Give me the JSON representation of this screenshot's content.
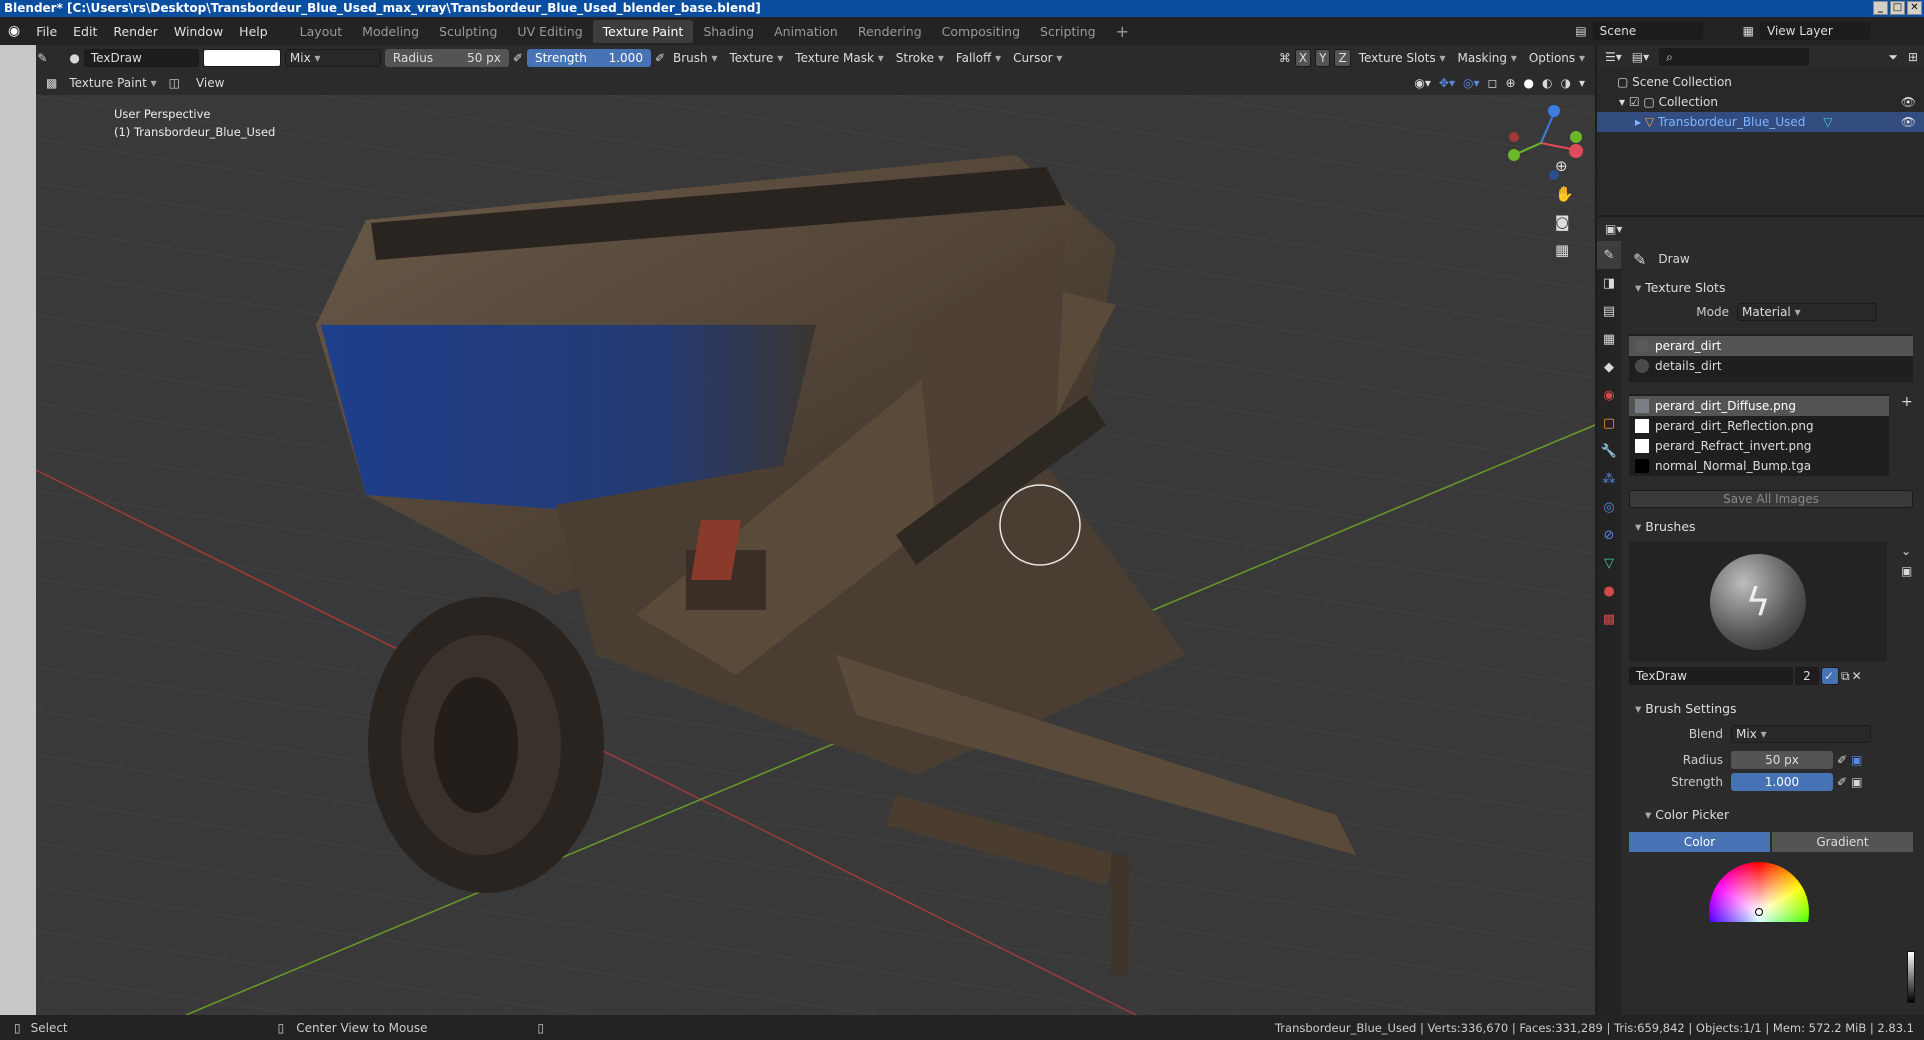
{
  "window": {
    "title": "Blender* [C:\\Users\\rs\\Desktop\\Transbordeur_Blue_Used_max_vray\\Transbordeur_Blue_Used_blender_base.blend]"
  },
  "menu": [
    "File",
    "Edit",
    "Render",
    "Window",
    "Help"
  ],
  "workspaces": [
    "Layout",
    "Modeling",
    "Sculpting",
    "UV Editing",
    "Texture Paint",
    "Shading",
    "Animation",
    "Rendering",
    "Compositing",
    "Scripting"
  ],
  "active_workspace": "Texture Paint",
  "scene": {
    "name": "Scene",
    "view_layer": "View Layer"
  },
  "tool_header": {
    "brush_name": "TexDraw",
    "blend": "Mix",
    "radius_label": "Radius",
    "radius_value": "50 px",
    "strength_label": "Strength",
    "strength_value": "1.000",
    "menus": [
      "Brush",
      "Texture",
      "Texture Mask",
      "Stroke",
      "Falloff",
      "Cursor"
    ],
    "axes": [
      "X",
      "Y",
      "Z"
    ],
    "right_menus": [
      "Texture Slots",
      "Masking",
      "Options"
    ]
  },
  "viewport_header": {
    "mode": "Texture Paint",
    "view": "View"
  },
  "viewport": {
    "perspective": "User Perspective",
    "object": "(1) Transbordeur_Blue_Used"
  },
  "outliner": {
    "root": "Scene Collection",
    "collection": "Collection",
    "object": "Transbordeur_Blue_Used"
  },
  "properties": {
    "tool": "Draw",
    "texture_slots": {
      "header": "Texture Slots",
      "mode_label": "Mode",
      "mode_value": "Material",
      "materials": [
        "perard_dirt",
        "details_dirt"
      ],
      "images": [
        {
          "name": "perard_dirt_Diffuse.png",
          "color": "#7a7f86"
        },
        {
          "name": "perard_dirt_Reflection.png",
          "color": "#ffffff"
        },
        {
          "name": "perard_Refract_invert.png",
          "color": "#ffffff"
        },
        {
          "name": "normal_Normal_Bump.tga",
          "color": "#000000"
        }
      ],
      "save_all": "Save All Images"
    },
    "brushes": {
      "header": "Brushes",
      "name": "TexDraw",
      "users": "2"
    },
    "brush_settings": {
      "header": "Brush Settings",
      "blend_label": "Blend",
      "blend_value": "Mix",
      "radius_label": "Radius",
      "radius_value": "50 px",
      "strength_label": "Strength",
      "strength_value": "1.000"
    },
    "color_picker": {
      "header": "Color Picker",
      "tabs": [
        "Color",
        "Gradient"
      ]
    }
  },
  "status": {
    "select": "Select",
    "center": "Center View to Mouse",
    "stats": "Transbordeur_Blue_Used | Verts:336,670 | Faces:331,289 | Tris:659,842 | Objects:1/1 | Mem: 572.2 MiB | 2.83.1"
  },
  "colors": {
    "accent": "#4772b3",
    "titlebar": "#0a4ea0",
    "hopper_blue": "#1e3f8c"
  }
}
